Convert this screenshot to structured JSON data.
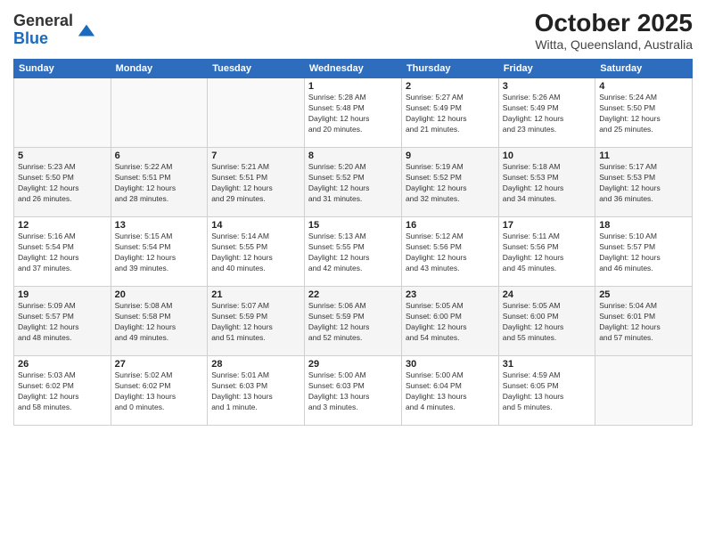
{
  "header": {
    "logo_general": "General",
    "logo_blue": "Blue",
    "title": "October 2025",
    "subtitle": "Witta, Queensland, Australia"
  },
  "days_of_week": [
    "Sunday",
    "Monday",
    "Tuesday",
    "Wednesday",
    "Thursday",
    "Friday",
    "Saturday"
  ],
  "weeks": [
    [
      {
        "day": "",
        "info": ""
      },
      {
        "day": "",
        "info": ""
      },
      {
        "day": "",
        "info": ""
      },
      {
        "day": "1",
        "info": "Sunrise: 5:28 AM\nSunset: 5:48 PM\nDaylight: 12 hours\nand 20 minutes."
      },
      {
        "day": "2",
        "info": "Sunrise: 5:27 AM\nSunset: 5:49 PM\nDaylight: 12 hours\nand 21 minutes."
      },
      {
        "day": "3",
        "info": "Sunrise: 5:26 AM\nSunset: 5:49 PM\nDaylight: 12 hours\nand 23 minutes."
      },
      {
        "day": "4",
        "info": "Sunrise: 5:24 AM\nSunset: 5:50 PM\nDaylight: 12 hours\nand 25 minutes."
      }
    ],
    [
      {
        "day": "5",
        "info": "Sunrise: 5:23 AM\nSunset: 5:50 PM\nDaylight: 12 hours\nand 26 minutes."
      },
      {
        "day": "6",
        "info": "Sunrise: 5:22 AM\nSunset: 5:51 PM\nDaylight: 12 hours\nand 28 minutes."
      },
      {
        "day": "7",
        "info": "Sunrise: 5:21 AM\nSunset: 5:51 PM\nDaylight: 12 hours\nand 29 minutes."
      },
      {
        "day": "8",
        "info": "Sunrise: 5:20 AM\nSunset: 5:52 PM\nDaylight: 12 hours\nand 31 minutes."
      },
      {
        "day": "9",
        "info": "Sunrise: 5:19 AM\nSunset: 5:52 PM\nDaylight: 12 hours\nand 32 minutes."
      },
      {
        "day": "10",
        "info": "Sunrise: 5:18 AM\nSunset: 5:53 PM\nDaylight: 12 hours\nand 34 minutes."
      },
      {
        "day": "11",
        "info": "Sunrise: 5:17 AM\nSunset: 5:53 PM\nDaylight: 12 hours\nand 36 minutes."
      }
    ],
    [
      {
        "day": "12",
        "info": "Sunrise: 5:16 AM\nSunset: 5:54 PM\nDaylight: 12 hours\nand 37 minutes."
      },
      {
        "day": "13",
        "info": "Sunrise: 5:15 AM\nSunset: 5:54 PM\nDaylight: 12 hours\nand 39 minutes."
      },
      {
        "day": "14",
        "info": "Sunrise: 5:14 AM\nSunset: 5:55 PM\nDaylight: 12 hours\nand 40 minutes."
      },
      {
        "day": "15",
        "info": "Sunrise: 5:13 AM\nSunset: 5:55 PM\nDaylight: 12 hours\nand 42 minutes."
      },
      {
        "day": "16",
        "info": "Sunrise: 5:12 AM\nSunset: 5:56 PM\nDaylight: 12 hours\nand 43 minutes."
      },
      {
        "day": "17",
        "info": "Sunrise: 5:11 AM\nSunset: 5:56 PM\nDaylight: 12 hours\nand 45 minutes."
      },
      {
        "day": "18",
        "info": "Sunrise: 5:10 AM\nSunset: 5:57 PM\nDaylight: 12 hours\nand 46 minutes."
      }
    ],
    [
      {
        "day": "19",
        "info": "Sunrise: 5:09 AM\nSunset: 5:57 PM\nDaylight: 12 hours\nand 48 minutes."
      },
      {
        "day": "20",
        "info": "Sunrise: 5:08 AM\nSunset: 5:58 PM\nDaylight: 12 hours\nand 49 minutes."
      },
      {
        "day": "21",
        "info": "Sunrise: 5:07 AM\nSunset: 5:59 PM\nDaylight: 12 hours\nand 51 minutes."
      },
      {
        "day": "22",
        "info": "Sunrise: 5:06 AM\nSunset: 5:59 PM\nDaylight: 12 hours\nand 52 minutes."
      },
      {
        "day": "23",
        "info": "Sunrise: 5:05 AM\nSunset: 6:00 PM\nDaylight: 12 hours\nand 54 minutes."
      },
      {
        "day": "24",
        "info": "Sunrise: 5:05 AM\nSunset: 6:00 PM\nDaylight: 12 hours\nand 55 minutes."
      },
      {
        "day": "25",
        "info": "Sunrise: 5:04 AM\nSunset: 6:01 PM\nDaylight: 12 hours\nand 57 minutes."
      }
    ],
    [
      {
        "day": "26",
        "info": "Sunrise: 5:03 AM\nSunset: 6:02 PM\nDaylight: 12 hours\nand 58 minutes."
      },
      {
        "day": "27",
        "info": "Sunrise: 5:02 AM\nSunset: 6:02 PM\nDaylight: 13 hours\nand 0 minutes."
      },
      {
        "day": "28",
        "info": "Sunrise: 5:01 AM\nSunset: 6:03 PM\nDaylight: 13 hours\nand 1 minute."
      },
      {
        "day": "29",
        "info": "Sunrise: 5:00 AM\nSunset: 6:03 PM\nDaylight: 13 hours\nand 3 minutes."
      },
      {
        "day": "30",
        "info": "Sunrise: 5:00 AM\nSunset: 6:04 PM\nDaylight: 13 hours\nand 4 minutes."
      },
      {
        "day": "31",
        "info": "Sunrise: 4:59 AM\nSunset: 6:05 PM\nDaylight: 13 hours\nand 5 minutes."
      },
      {
        "day": "",
        "info": ""
      }
    ]
  ]
}
